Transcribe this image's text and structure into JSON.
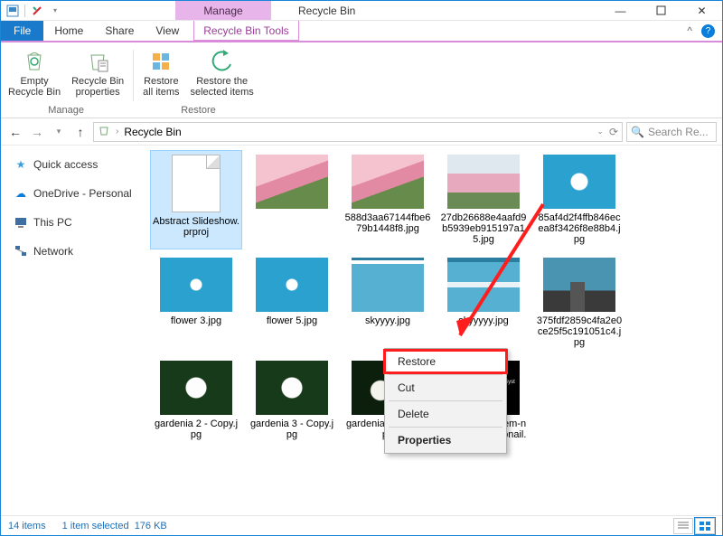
{
  "title": "Recycle Bin",
  "contextual_tab": "Manage",
  "tabs": {
    "file": "File",
    "home": "Home",
    "share": "Share",
    "view": "View",
    "context": "Recycle Bin Tools"
  },
  "ribbon": {
    "groups": [
      {
        "label": "Manage",
        "buttons": [
          "Empty\nRecycle Bin",
          "Recycle Bin\nproperties"
        ]
      },
      {
        "label": "Restore",
        "buttons": [
          "Restore\nall items",
          "Restore the\nselected items"
        ]
      }
    ]
  },
  "breadcrumb": {
    "root_chevron": "›",
    "location": "Recycle Bin"
  },
  "search_placeholder": "Search Re...",
  "nav": [
    {
      "label": "Quick access",
      "icon": "star"
    },
    {
      "label": "OneDrive - Personal",
      "icon": "cloud"
    },
    {
      "label": "This PC",
      "icon": "pc"
    },
    {
      "label": "Network",
      "icon": "network"
    }
  ],
  "items": [
    {
      "name": "Abstract Slideshow.prproj",
      "kind": "file",
      "selected": true
    },
    {
      "name": "",
      "kind": "thumb-flowers-pink"
    },
    {
      "name": "588d3aa67144fbe679b1448f8.jpg",
      "kind": "thumb-flowers-pink"
    },
    {
      "name": "27db26688e4aafd9b5939eb915197a15.jpg",
      "kind": "thumb-flowers-vase"
    },
    {
      "name": "85af4d2f4ffb846ecea8f3426f8e88b4.jpg",
      "kind": "thumb-blue-white"
    },
    {
      "name": "flower 3.jpg",
      "kind": "thumb-white-small"
    },
    {
      "name": "flower 5.jpg",
      "kind": "thumb-white-small"
    },
    {
      "name": "skyyyy.jpg",
      "kind": "thumb-sky"
    },
    {
      "name": "skyyyyy.jpg",
      "kind": "thumb-sky2"
    },
    {
      "name": "375fdf2859c4fa2e0ce25f5c191051c4.jpg",
      "kind": "thumb-building"
    },
    {
      "name": "gardenia 2 - Copy.jpg",
      "kind": "thumb-gardenia"
    },
    {
      "name": "gardenia 3 - Copy.jpg",
      "kind": "thumb-gardenia"
    },
    {
      "name": "gardenia 4 - Copy.jpg",
      "kind": "thumb-gardenia-dark"
    },
    {
      "name": "operating-system-not-found-thumbnail.png",
      "kind": "thumb-black-text",
      "text": "How to Fix Operating System Not Found?"
    }
  ],
  "context_menu": {
    "restore": "Restore",
    "cut": "Cut",
    "delete": "Delete",
    "properties": "Properties"
  },
  "status": {
    "count": "14 items",
    "selection": "1 item selected",
    "size": "176 KB"
  }
}
